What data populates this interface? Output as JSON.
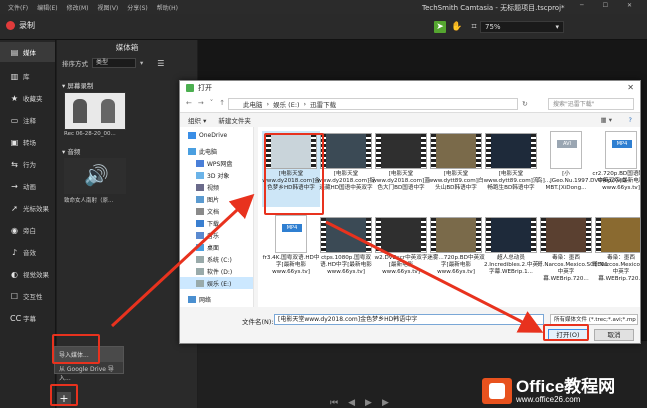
{
  "menu": [
    "文件(F)",
    "编辑(E)",
    "修改(M)",
    "视图(V)",
    "分享(S)",
    "帮助(H)"
  ],
  "window_title": "TechSmith Camtasia - 无标题项目.tscproj*",
  "record_label": "录制",
  "zoom_value": "75%",
  "sidebar": [
    {
      "label": "媒体",
      "icon": "media-icon"
    },
    {
      "label": "库",
      "icon": "library-icon"
    },
    {
      "label": "收藏夹",
      "icon": "favorites-icon"
    },
    {
      "label": "注释",
      "icon": "annotation-icon"
    },
    {
      "label": "转场",
      "icon": "transition-icon"
    },
    {
      "label": "行为",
      "icon": "behavior-icon"
    },
    {
      "label": "动画",
      "icon": "animation-icon"
    },
    {
      "label": "光标效果",
      "icon": "cursor-effect-icon"
    },
    {
      "label": "旁白",
      "icon": "narration-icon"
    },
    {
      "label": "音效",
      "icon": "audio-effect-icon"
    },
    {
      "label": "视觉效果",
      "icon": "visual-effect-icon"
    },
    {
      "label": "交互性",
      "icon": "interactivity-icon"
    },
    {
      "label": "字幕",
      "icon": "captions-icon"
    }
  ],
  "bin": {
    "title": "媒体箱",
    "sort_label": "排序方式",
    "sort_value": "类型",
    "section_screen": "屏幕录制",
    "rec_name": "Rec 06-28-20_00...",
    "section_audio": "音频",
    "audio_name": "致命女人南射（原..."
  },
  "import_menu": {
    "item1": "导入媒体...",
    "item2": "从 Google Drive 导入..."
  },
  "plus_label": "+",
  "dialog": {
    "title": "打开",
    "breadcrumb": [
      "此电脑",
      "娱乐 (E:)",
      "迅雷下载"
    ],
    "search_placeholder": "搜索\"迅雷下载\"",
    "organize": "组织 ▾",
    "new_folder": "新建文件夹",
    "tree": [
      {
        "label": "OneDrive",
        "icon": "cloud-icon",
        "sel": false
      },
      {
        "label": "此电脑",
        "icon": "computer-icon",
        "sel": false
      },
      {
        "label": "WPS网盘",
        "icon": "cloud-drive-icon",
        "sel": false
      },
      {
        "label": "3D 对象",
        "icon": "cube-icon",
        "sel": false
      },
      {
        "label": "视频",
        "icon": "video-folder-icon",
        "sel": false
      },
      {
        "label": "图片",
        "icon": "picture-folder-icon",
        "sel": false
      },
      {
        "label": "文档",
        "icon": "document-folder-icon",
        "sel": false
      },
      {
        "label": "下载",
        "icon": "download-folder-icon",
        "sel": false
      },
      {
        "label": "音乐",
        "icon": "music-folder-icon",
        "sel": false
      },
      {
        "label": "桌面",
        "icon": "desktop-folder-icon",
        "sel": false
      },
      {
        "label": "系统 (C:)",
        "icon": "drive-icon",
        "sel": false
      },
      {
        "label": "软件 (D:)",
        "icon": "drive-icon",
        "sel": false
      },
      {
        "label": "娱乐 (E:)",
        "icon": "drive-icon",
        "sel": true
      },
      {
        "label": "网络",
        "icon": "network-icon",
        "sel": false
      }
    ],
    "files_row1": [
      {
        "name": "[电影天堂www.dy2018.com]金色梦乡HD韩语中字",
        "type": "video",
        "sel": true
      },
      {
        "name": "[电影天堂www.dy2018.com]捉迷藏HD国语中英双字",
        "type": "video",
        "sel": false
      },
      {
        "name": "[电影天堂www.dy2018.com]蓝色大门BD国语中字",
        "type": "video",
        "sel": false
      },
      {
        "name": "[电影天堂www.dytt89.com]白头山BD韩语中字",
        "type": "video",
        "sel": false
      },
      {
        "name": "[电影天堂www.dytt89.com]流畅跑生BD韩语中字",
        "type": "video",
        "sel": false
      },
      {
        "name": "[小鸟]...JGeo.Nu.1997.DVDRip.XviD-MBT.[XiDong...",
        "type": "avi",
        "sel": false
      },
      {
        "name": "cr2.720p.BD国语配音中英双字[最新电影www.66ys.tv]",
        "type": "mp4",
        "sel": false
      }
    ],
    "files_row2": [
      {
        "name": "fr3.4K.国粤双语.HD中字[最新电影www.66ys.tv]",
        "type": "mp4",
        "sel": false
      },
      {
        "name": "ctps.1080p.国粤双语.HD中字[最新电影www.66ys.tv]",
        "type": "video",
        "sel": false
      },
      {
        "name": "w2.DVDscr中英双字[最新电影www.66ys.tv]",
        "type": "video",
        "sel": false
      },
      {
        "name": "迷雾...720p.BD中英双字[最新电影www.66ys.tv]",
        "type": "video",
        "sel": false
      },
      {
        "name": "超人总动员2.Incredibles.2.中英字幕.WEBrip.1...",
        "type": "video",
        "sel": false
      },
      {
        "name": "毒枭：墨西哥.Narcos.Mexico.S01E01.中英字幕.WEBrip.720...",
        "type": "video",
        "sel": false
      },
      {
        "name": "毒枭：墨西哥.Narcos.Mexico.S01E02.中英字幕.WEBrip.720...",
        "type": "video",
        "sel": false
      }
    ],
    "filename_label": "文件名(N):",
    "filename_value": "[电影天堂www.dy2018.com]金色梦乡HD韩语中字",
    "filter_value": "所有媒体文件 (*.trec;*.avi;*.mp",
    "open_label": "打开(O)",
    "cancel_label": "取消"
  },
  "logo": {
    "title": "Office教程网",
    "url": "www.office26.com"
  },
  "colors": {
    "accent_green": "#55a630",
    "highlight_red": "#e8321e",
    "logo_orange": "#e8521e",
    "selection_blue": "#cde6f7"
  }
}
